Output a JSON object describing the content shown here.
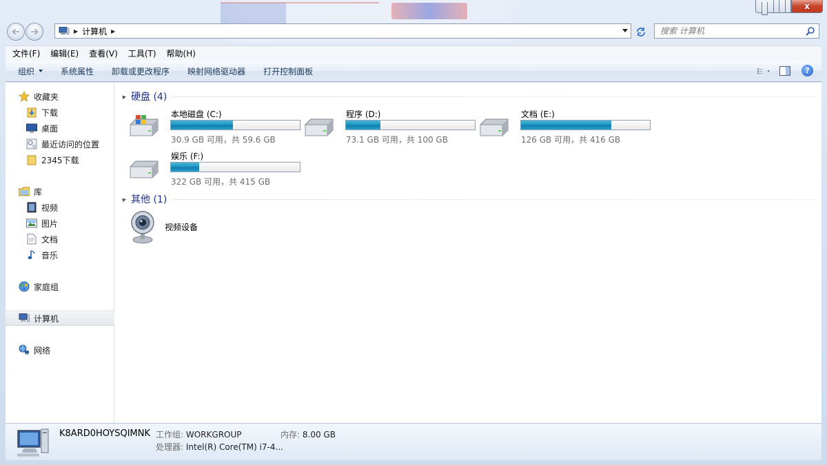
{
  "window": {
    "minimize_label": "",
    "maximize_label": "",
    "close_label": "x"
  },
  "nav": {
    "breadcrumb": "计算机",
    "search_placeholder": "搜索 计算机"
  },
  "menu": {
    "items": [
      "文件(F)",
      "编辑(E)",
      "查看(V)",
      "工具(T)",
      "帮助(H)"
    ]
  },
  "toolbar": {
    "organize": "组织",
    "system_properties": "系统属性",
    "uninstall": "卸载或更改程序",
    "map_drive": "映射网络驱动器",
    "control_panel": "打开控制面板"
  },
  "sidebar": {
    "favorites": "收藏夹",
    "downloads": "下载",
    "desktop": "桌面",
    "recent": "最近访问的位置",
    "downloads2345": "2345下载",
    "libraries": "库",
    "videos": "视频",
    "pictures": "图片",
    "documents": "文档",
    "music": "音乐",
    "homegroup": "家庭组",
    "computer": "计算机",
    "network": "网络"
  },
  "groups": {
    "hdd": "硬盘 (4)",
    "other": "其他 (1)"
  },
  "drives": [
    {
      "name": "本地磁盘 (C:)",
      "free": "30.9 GB 可用，共 59.6 GB",
      "used_pct": 48,
      "icon": "windows-drive-icon"
    },
    {
      "name": "程序 (D:)",
      "free": "73.1 GB 可用，共 100 GB",
      "used_pct": 27,
      "icon": "hard-drive-icon"
    },
    {
      "name": "文档 (E:)",
      "free": "126 GB 可用，共 416 GB",
      "used_pct": 70,
      "icon": "hard-drive-icon"
    },
    {
      "name": "娱乐 (F:)",
      "free": "322 GB 可用，共 415 GB",
      "used_pct": 22,
      "icon": "hard-drive-icon"
    }
  ],
  "other_devices": [
    {
      "name": "视频设备",
      "icon": "webcam-icon"
    }
  ],
  "details": {
    "computer_name": "K8ARD0HOYSQIMNK",
    "workgroup_label": "工作组:",
    "workgroup": "WORKGROUP",
    "memory_label": "内存:",
    "memory": "8.00 GB",
    "cpu_label": "处理器:",
    "cpu": "Intel(R) Core(TM) i7-4..."
  },
  "colors": {
    "bar_fill": "#1f97c4",
    "group_header": "#1e3287",
    "toolbar_text": "#1e395b"
  }
}
